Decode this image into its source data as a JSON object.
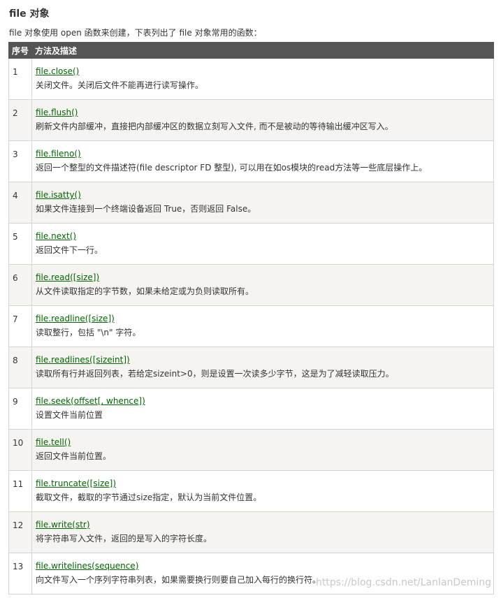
{
  "heading": "file 对象",
  "intro": "file 对象使用 open 函数来创建，下表列出了 file 对象常用的函数：",
  "table": {
    "headers": [
      "序号",
      "方法及描述"
    ],
    "rows": [
      {
        "num": "1",
        "parts": [
          "file.close",
          "()"
        ],
        "desc": "关闭文件。关闭后文件不能再进行读写操作。"
      },
      {
        "num": "2",
        "parts": [
          "file.flush",
          "()"
        ],
        "desc": "刷新文件内部缓冲，直接把内部缓冲区的数据立刻写入文件, 而不是被动的等待输出缓冲区写入。"
      },
      {
        "num": "3",
        "parts": [
          "file.fileno",
          "()"
        ],
        "desc": "返回一个整型的文件描述符(file descriptor FD 整型), 可以用在如os模块的read方法等一些底层操作上。"
      },
      {
        "num": "4",
        "parts": [
          "file.isatty",
          "()"
        ],
        "desc": "如果文件连接到一个终端设备返回 True，否则返回 False。"
      },
      {
        "num": "5",
        "parts": [
          "file.next",
          "()"
        ],
        "desc": "返回文件下一行。"
      },
      {
        "num": "6",
        "parts": [
          "file.read",
          "([",
          "size",
          "])"
        ],
        "desc": "从文件读取指定的字节数，如果未给定或为负则读取所有。"
      },
      {
        "num": "7",
        "parts": [
          "file.readline",
          "([",
          "size",
          "])"
        ],
        "desc": "读取整行，包括 \"\\n\" 字符。"
      },
      {
        "num": "8",
        "parts": [
          "file.readlines",
          "([",
          "sizeint",
          "])"
        ],
        "desc": "读取所有行并返回列表，若给定sizeint>0，则是设置一次读多少字节，这是为了减轻读取压力。"
      },
      {
        "num": "9",
        "parts": [
          "file.seek",
          "(",
          "offset",
          "[, ",
          "whence",
          "])"
        ],
        "desc": "设置文件当前位置"
      },
      {
        "num": "10",
        "parts": [
          "file.tell",
          "()"
        ],
        "desc": "返回文件当前位置。"
      },
      {
        "num": "11",
        "parts": [
          "file.truncate",
          "([",
          "size",
          "])"
        ],
        "desc": "截取文件，截取的字节通过size指定，默认为当前文件位置。"
      },
      {
        "num": "12",
        "parts": [
          "file.write",
          "(",
          "str",
          ")"
        ],
        "desc": "将字符串写入文件，返回的是写入的字符长度。"
      },
      {
        "num": "13",
        "parts": [
          "file.writelines",
          "(",
          "sequence",
          ")"
        ],
        "desc": "向文件写入一个序列字符串列表，如果需要换行则要自己加入每行的换行符。"
      }
    ]
  },
  "watermark": "https://blog.csdn.net/LanlanDeming",
  "colors": {
    "header_bg": "#555555",
    "link": "#006600",
    "alt_row_bg": "#f6f4f0"
  }
}
